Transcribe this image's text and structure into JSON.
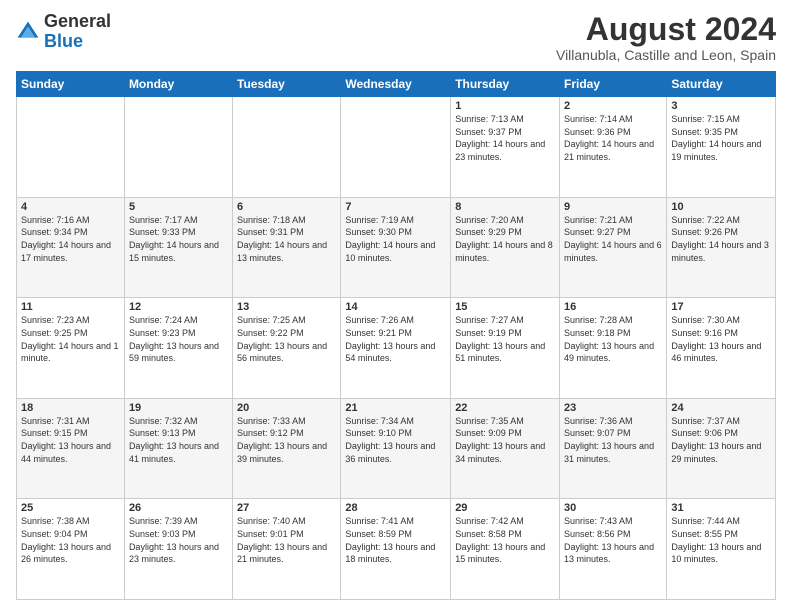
{
  "header": {
    "logo_general": "General",
    "logo_blue": "Blue",
    "title": "August 2024",
    "subtitle": "Villanubla, Castille and Leon, Spain"
  },
  "weekdays": [
    "Sunday",
    "Monday",
    "Tuesday",
    "Wednesday",
    "Thursday",
    "Friday",
    "Saturday"
  ],
  "weeks": [
    [
      {
        "day": "",
        "info": ""
      },
      {
        "day": "",
        "info": ""
      },
      {
        "day": "",
        "info": ""
      },
      {
        "day": "",
        "info": ""
      },
      {
        "day": "1",
        "info": "Sunrise: 7:13 AM\nSunset: 9:37 PM\nDaylight: 14 hours and 23 minutes."
      },
      {
        "day": "2",
        "info": "Sunrise: 7:14 AM\nSunset: 9:36 PM\nDaylight: 14 hours and 21 minutes."
      },
      {
        "day": "3",
        "info": "Sunrise: 7:15 AM\nSunset: 9:35 PM\nDaylight: 14 hours and 19 minutes."
      }
    ],
    [
      {
        "day": "4",
        "info": "Sunrise: 7:16 AM\nSunset: 9:34 PM\nDaylight: 14 hours and 17 minutes."
      },
      {
        "day": "5",
        "info": "Sunrise: 7:17 AM\nSunset: 9:33 PM\nDaylight: 14 hours and 15 minutes."
      },
      {
        "day": "6",
        "info": "Sunrise: 7:18 AM\nSunset: 9:31 PM\nDaylight: 14 hours and 13 minutes."
      },
      {
        "day": "7",
        "info": "Sunrise: 7:19 AM\nSunset: 9:30 PM\nDaylight: 14 hours and 10 minutes."
      },
      {
        "day": "8",
        "info": "Sunrise: 7:20 AM\nSunset: 9:29 PM\nDaylight: 14 hours and 8 minutes."
      },
      {
        "day": "9",
        "info": "Sunrise: 7:21 AM\nSunset: 9:27 PM\nDaylight: 14 hours and 6 minutes."
      },
      {
        "day": "10",
        "info": "Sunrise: 7:22 AM\nSunset: 9:26 PM\nDaylight: 14 hours and 3 minutes."
      }
    ],
    [
      {
        "day": "11",
        "info": "Sunrise: 7:23 AM\nSunset: 9:25 PM\nDaylight: 14 hours and 1 minute."
      },
      {
        "day": "12",
        "info": "Sunrise: 7:24 AM\nSunset: 9:23 PM\nDaylight: 13 hours and 59 minutes."
      },
      {
        "day": "13",
        "info": "Sunrise: 7:25 AM\nSunset: 9:22 PM\nDaylight: 13 hours and 56 minutes."
      },
      {
        "day": "14",
        "info": "Sunrise: 7:26 AM\nSunset: 9:21 PM\nDaylight: 13 hours and 54 minutes."
      },
      {
        "day": "15",
        "info": "Sunrise: 7:27 AM\nSunset: 9:19 PM\nDaylight: 13 hours and 51 minutes."
      },
      {
        "day": "16",
        "info": "Sunrise: 7:28 AM\nSunset: 9:18 PM\nDaylight: 13 hours and 49 minutes."
      },
      {
        "day": "17",
        "info": "Sunrise: 7:30 AM\nSunset: 9:16 PM\nDaylight: 13 hours and 46 minutes."
      }
    ],
    [
      {
        "day": "18",
        "info": "Sunrise: 7:31 AM\nSunset: 9:15 PM\nDaylight: 13 hours and 44 minutes."
      },
      {
        "day": "19",
        "info": "Sunrise: 7:32 AM\nSunset: 9:13 PM\nDaylight: 13 hours and 41 minutes."
      },
      {
        "day": "20",
        "info": "Sunrise: 7:33 AM\nSunset: 9:12 PM\nDaylight: 13 hours and 39 minutes."
      },
      {
        "day": "21",
        "info": "Sunrise: 7:34 AM\nSunset: 9:10 PM\nDaylight: 13 hours and 36 minutes."
      },
      {
        "day": "22",
        "info": "Sunrise: 7:35 AM\nSunset: 9:09 PM\nDaylight: 13 hours and 34 minutes."
      },
      {
        "day": "23",
        "info": "Sunrise: 7:36 AM\nSunset: 9:07 PM\nDaylight: 13 hours and 31 minutes."
      },
      {
        "day": "24",
        "info": "Sunrise: 7:37 AM\nSunset: 9:06 PM\nDaylight: 13 hours and 29 minutes."
      }
    ],
    [
      {
        "day": "25",
        "info": "Sunrise: 7:38 AM\nSunset: 9:04 PM\nDaylight: 13 hours and 26 minutes."
      },
      {
        "day": "26",
        "info": "Sunrise: 7:39 AM\nSunset: 9:03 PM\nDaylight: 13 hours and 23 minutes."
      },
      {
        "day": "27",
        "info": "Sunrise: 7:40 AM\nSunset: 9:01 PM\nDaylight: 13 hours and 21 minutes."
      },
      {
        "day": "28",
        "info": "Sunrise: 7:41 AM\nSunset: 8:59 PM\nDaylight: 13 hours and 18 minutes."
      },
      {
        "day": "29",
        "info": "Sunrise: 7:42 AM\nSunset: 8:58 PM\nDaylight: 13 hours and 15 minutes."
      },
      {
        "day": "30",
        "info": "Sunrise: 7:43 AM\nSunset: 8:56 PM\nDaylight: 13 hours and 13 minutes."
      },
      {
        "day": "31",
        "info": "Sunrise: 7:44 AM\nSunset: 8:55 PM\nDaylight: 13 hours and 10 minutes."
      }
    ]
  ]
}
